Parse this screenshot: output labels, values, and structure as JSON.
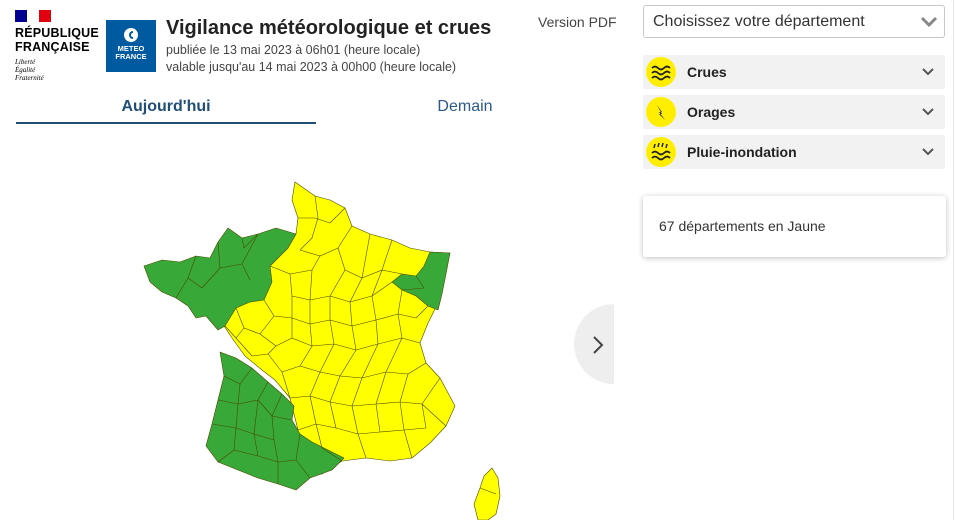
{
  "header": {
    "republique": [
      "RÉPUBLIQUE",
      "FRANÇAISE"
    ],
    "motto": [
      "Liberté",
      "Égalité",
      "Fraternité"
    ],
    "meteo_logo": [
      "METEO",
      "FRANCE"
    ],
    "title": "Vigilance météorologique et crues",
    "published": "publiée le 13 mai 2023 à 06h01 (heure locale)",
    "valid": "valable jusqu'au 14 mai 2023 à 00h00 (heure locale)",
    "pdf_link": "Version PDF"
  },
  "tabs": [
    {
      "label": "Aujourd'hui",
      "active": true
    },
    {
      "label": "Demain",
      "active": false
    }
  ],
  "department_select": {
    "placeholder": "Choisissez votre département"
  },
  "hazards": [
    {
      "label": "Crues",
      "icon": "flood-waves-icon"
    },
    {
      "label": "Orages",
      "icon": "lightning-icon"
    },
    {
      "label": "Pluie-inondation",
      "icon": "rain-flood-icon"
    }
  ],
  "summary": {
    "text": "67 départements en Jaune"
  },
  "colors": {
    "green": "#38a838",
    "yellow": "#ffff00",
    "tab_blue": "#1f4e79",
    "brand_blue": "#005aa0",
    "flag_blue": "#000091",
    "flag_red": "#e1000f"
  }
}
